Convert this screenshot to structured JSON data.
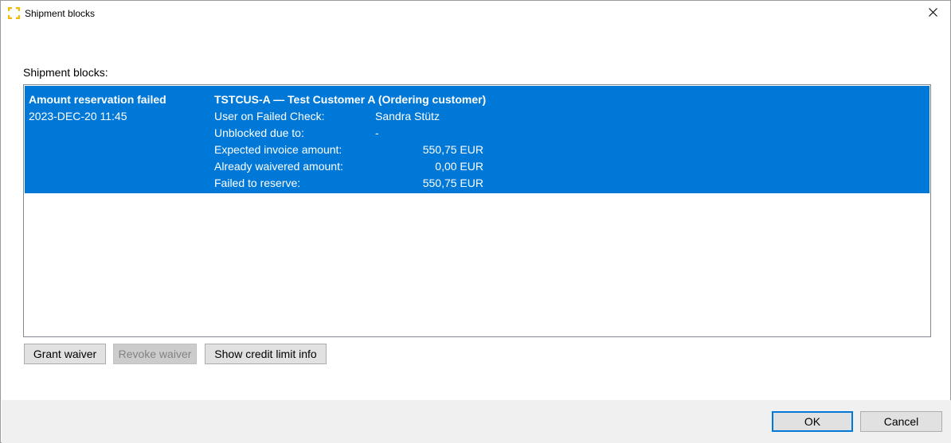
{
  "window": {
    "title": "Shipment blocks",
    "close_icon": "close-icon",
    "app_icon": "corner-brackets-icon",
    "app_icon_color": "#f5b800"
  },
  "main": {
    "section_label": "Shipment blocks:",
    "selected_color": "#0078d7",
    "blocks": [
      {
        "reason": "Amount reservation failed",
        "timestamp": "2023-DEC-20 11:45",
        "customer": "TSTCUS-A — Test Customer A (Ordering customer)",
        "user_label": "User on Failed Check:",
        "user_value": "Sandra Stütz",
        "unblocked_label": "Unblocked due to:",
        "unblocked_value": "-",
        "expected_label": "Expected invoice amount:",
        "expected_value": "550,75 EUR",
        "waivered_label": "Already waivered amount:",
        "waivered_value": "0,00 EUR",
        "failed_label": "Failed to reserve:",
        "failed_value": "550,75 EUR"
      }
    ]
  },
  "actions": {
    "grant_waiver": "Grant waiver",
    "revoke_waiver": "Revoke waiver",
    "show_credit_limit": "Show credit limit info"
  },
  "footer": {
    "ok": "OK",
    "cancel": "Cancel"
  }
}
